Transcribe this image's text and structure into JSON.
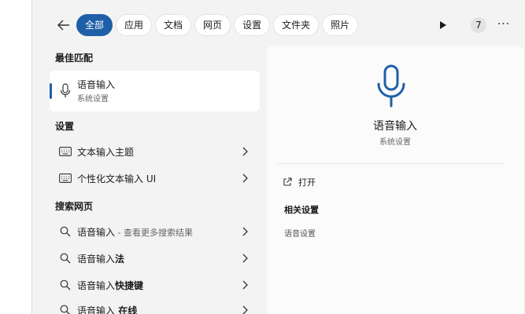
{
  "tabs": [
    {
      "label": "全部",
      "active": true
    },
    {
      "label": "应用"
    },
    {
      "label": "文档"
    },
    {
      "label": "网页"
    },
    {
      "label": "设置"
    },
    {
      "label": "文件夹"
    },
    {
      "label": "照片"
    }
  ],
  "badge_count": "7",
  "more_label": "···",
  "sections": {
    "best_match": "最佳匹配",
    "settings": "设置",
    "web_search": "搜索网页"
  },
  "best_match": {
    "title": "语音输入",
    "subtitle": "系统设置"
  },
  "settings_items": [
    {
      "label": "文本输入主题"
    },
    {
      "label": "个性化文本输入 UI"
    }
  ],
  "web_items": [
    {
      "query": "语音输入",
      "suffix": " - 查看更多搜索结果"
    },
    {
      "query": "语音输入",
      "bold": "法"
    },
    {
      "query": "语音输入",
      "bold": "快捷键"
    },
    {
      "query": "语音输入",
      "bold": " 在线"
    }
  ],
  "detail": {
    "title": "语音输入",
    "subtitle": "系统设置",
    "open_label": "打开",
    "related_title": "相关设置",
    "related_link": "语音设置"
  },
  "colors": {
    "accent": "#1f5fa8"
  }
}
